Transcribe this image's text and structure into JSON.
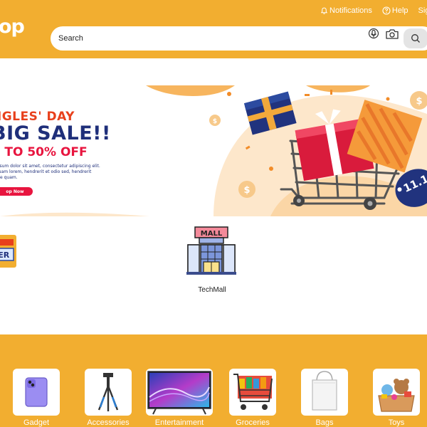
{
  "header": {
    "logo_text": "op",
    "notifications_label": "Notifications",
    "help_label": "Help",
    "signup_label": "Sig"
  },
  "search": {
    "placeholder": "Search"
  },
  "banner": {
    "line1": "NGLES' DAY",
    "line2": "BIG SALE!!",
    "line3": "P TO 50% OFF",
    "body": "ipsum dolor sit amet, consectetur adipiscing elit.\n quam lorem, hendrerit et odio sed, hendrerit\nate quam.",
    "cta_label": "op Now",
    "tag_text": "11.1"
  },
  "stores": [
    {
      "label": "HER"
    },
    {
      "label": "TechMall",
      "sign": "MALL"
    }
  ],
  "categories": [
    {
      "label": "Gadget",
      "icon": "phone-icon"
    },
    {
      "label": "Accessories",
      "icon": "tripod-icon"
    },
    {
      "label": "Entertainment",
      "icon": "tv-icon"
    },
    {
      "label": "Groceries",
      "icon": "cart-icon"
    },
    {
      "label": "Bags",
      "icon": "bag-icon"
    },
    {
      "label": "Toys",
      "icon": "toys-icon"
    }
  ],
  "colors": {
    "brand": "#F2AE30",
    "headline_orange": "#E8401C",
    "headline_navy": "#1F2F7A",
    "accent_red": "#E8153F"
  }
}
